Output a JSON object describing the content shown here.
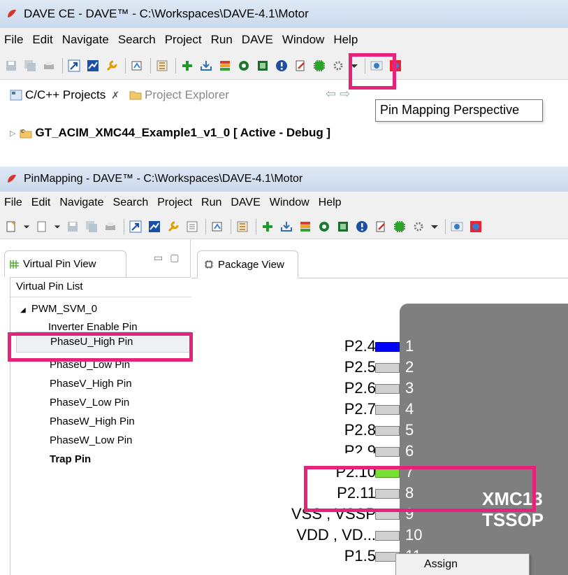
{
  "top": {
    "title": "DAVE CE - DAVE™ - C:\\Workspaces\\DAVE-4.1\\Motor",
    "menu": [
      "File",
      "Edit",
      "Navigate",
      "Search",
      "Project",
      "Run",
      "DAVE",
      "Window",
      "Help"
    ],
    "tabs": {
      "cpp_projects": "C/C++ Projects",
      "cpp_close": "✗",
      "project_explorer": "Project Explorer"
    },
    "nav_arrows": "⇦ ⇨",
    "tooltip": "Pin Mapping Perspective",
    "project_node": "GT_ACIM_XMC44_Example1_v1_0 [ Active - Debug ]"
  },
  "bottom": {
    "title": "PinMapping - DAVE™ - C:\\Workspaces\\DAVE-4.1\\Motor",
    "menu": [
      "File",
      "Edit",
      "Navigate",
      "Search",
      "Project",
      "Run",
      "DAVE",
      "Window",
      "Help"
    ],
    "left_view_tab": "Virtual Pin View",
    "list_header": "Virtual Pin List",
    "list_root": "PWM_SVM_0",
    "pins": [
      "Inverter Enable Pin",
      "PhaseU_High Pin",
      "PhaseU_Low Pin",
      "PhaseV_High Pin",
      "PhaseV_Low Pin",
      "PhaseW_High Pin",
      "PhaseW_Low Pin",
      "Trap Pin"
    ],
    "package_tab": "Package View",
    "package_pins": [
      {
        "label": "P2.4",
        "num": "1"
      },
      {
        "label": "P2.5",
        "num": "2"
      },
      {
        "label": "P2.6",
        "num": "3"
      },
      {
        "label": "P2.7",
        "num": "4"
      },
      {
        "label": "P2.8",
        "num": "5"
      },
      {
        "label": "P2.9",
        "num": "6"
      },
      {
        "label": "P2.10",
        "num": "7"
      },
      {
        "label": "P2.11",
        "num": "8"
      },
      {
        "label": "VSS , VSSP",
        "num": "9"
      },
      {
        "label": "VDD , VD...",
        "num": "10"
      },
      {
        "label": "P1.5",
        "num": "11"
      }
    ],
    "chip_line1": "XMC13",
    "chip_line2": "TSSOP",
    "context_menu_item": "Assign"
  },
  "colors": {
    "highlight": "#e5237a",
    "assigned_pin": "#0000ff",
    "selected_pin": "#77e034",
    "chip": "#7f7f7f"
  }
}
